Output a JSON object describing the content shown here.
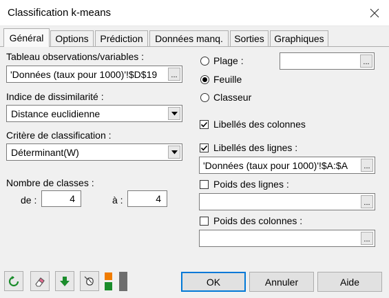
{
  "window": {
    "title": "Classification k-means",
    "close_icon": "close-icon"
  },
  "tabs": [
    {
      "label": "Général",
      "active": true
    },
    {
      "label": "Options",
      "active": false
    },
    {
      "label": "Prédiction",
      "active": false
    },
    {
      "label": "Données manq.",
      "active": false
    },
    {
      "label": "Sorties",
      "active": false
    },
    {
      "label": "Graphiques",
      "active": false
    }
  ],
  "general": {
    "observations": {
      "label": "Tableau observations/variables :",
      "value": "'Données (taux pour 1000)'!$D$19",
      "browse_label": "..."
    },
    "dissimilarity": {
      "label": "Indice de dissimilarité :",
      "selected": "Distance euclidienne"
    },
    "criterion": {
      "label": "Critère de classification :",
      "selected": "Déterminant(W)"
    },
    "classes": {
      "label": "Nombre de classes :",
      "from_label": "de :",
      "from_value": "4",
      "to_label": "à :",
      "to_value": "4"
    },
    "range_options": {
      "plage_label": "Plage :",
      "plage_value": "",
      "feuille_label": "Feuille",
      "classeur_label": "Classeur",
      "selected": "Feuille"
    },
    "column_labels": {
      "label": "Libellés des colonnes",
      "checked": true
    },
    "row_labels": {
      "label": "Libellés des lignes :",
      "checked": true,
      "value": "'Données (taux pour 1000)'!$A:$A"
    },
    "row_weights": {
      "label": "Poids des lignes :",
      "checked": false,
      "value": ""
    },
    "column_weights": {
      "label": "Poids des colonnes :",
      "checked": false,
      "value": ""
    }
  },
  "footer": {
    "ok_label": "OK",
    "cancel_label": "Annuler",
    "help_label": "Aide",
    "tools": [
      "reset-icon",
      "eraser-icon",
      "download-arrow-icon",
      "mouse-icon",
      "layout-toggle-icon"
    ]
  },
  "colors": {
    "window_bg": "#f0f0f0",
    "accent": "#0078d7",
    "green_icon": "#1a8c2b",
    "orange_icon": "#f07c00"
  }
}
